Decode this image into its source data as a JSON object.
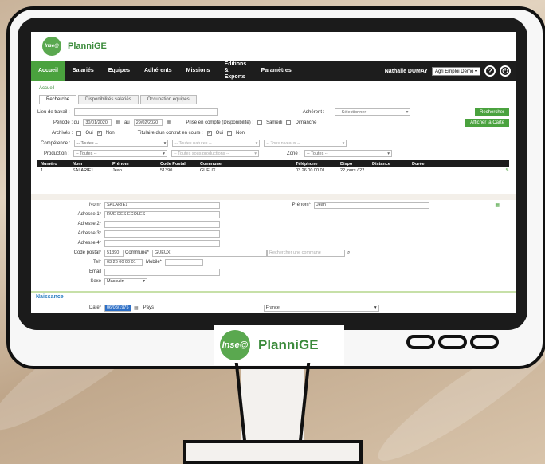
{
  "app": {
    "name": "PlanniGE",
    "logo_text": "Inse@"
  },
  "nav": {
    "items": [
      "Accueil",
      "Salariés",
      "Equipes",
      "Adhérents",
      "Missions",
      "Editions & Exports",
      "Paramètres"
    ],
    "user": "Nathalie DUMAY",
    "company_select": "Agri Emploi Demo",
    "help_icon": "help-icon",
    "power_icon": "power-icon"
  },
  "breadcrumb": "Accueil",
  "tabs": [
    "Recherche",
    "Disponibilités salariés",
    "Occupation équipes"
  ],
  "search": {
    "lieu_label": "Lieu de travail :",
    "adherent_label": "Adhérent :",
    "adherent_value": "-- Sélectionner --",
    "search_button": "Rechercher",
    "map_button": "Afficher la Carte",
    "periode_label": "Période : du",
    "date_from": "30/01/2020",
    "au_label": "au",
    "date_to": "29/02/2020",
    "prise_label": "Prise en compte (Disponibilité) :",
    "samedi": "Samedi",
    "dimanche": "Dimanche",
    "archives_label": "Archivés :",
    "oui": "Oui",
    "non": "Non",
    "titulaire_label": "Titulaire d'un contrat en cours :",
    "competence_label": "Compétence :",
    "competence_value": "-- Toutes --",
    "natures_value": "-- Toutes natures --",
    "niveaux_value": "-- Tous niveaux --",
    "production_label": "Production :",
    "production_value": "-- Toutes --",
    "productions_value": "-- Toutes sous productions --",
    "zone_label": "Zone :",
    "zone_value": "-- Toutes --"
  },
  "table": {
    "headers": [
      "Numéro",
      "Nom",
      "Prénom",
      "Code Postal",
      "Commune",
      "Téléphone",
      "Dispo",
      "Distance",
      "Durée"
    ],
    "rows": [
      [
        "1",
        "SALARIE1",
        "Jean",
        "51390",
        "GUEUX",
        "03 26 00 00 01",
        "22 jours / 22",
        "",
        ""
      ]
    ]
  },
  "form": {
    "nom_label": "Nom*",
    "nom_value": "SALARIE1",
    "prenom_label": "Prénom*",
    "prenom_value": "Jean",
    "adresse1_label": "Adresse 1*",
    "adresse1_value": "RUE DES ECOLES",
    "adresse2_label": "Adresse 2*",
    "adresse3_label": "Adresse 3*",
    "adresse4_label": "Adresse 4*",
    "cp_label": "Code postal*",
    "cp_value": "51390",
    "commune_label": "Commune*",
    "commune_value": "GUEUX",
    "commune_search_placeholder": "Rechercher une commune",
    "tel_label": "Tel*",
    "tel_value": "03 26 00 00 01",
    "mobile_label": "Mobile*",
    "email_label": "Email",
    "sexe_label": "Sexe",
    "sexe_value": "Masculin"
  },
  "naissance": {
    "title": "Naissance",
    "date_label": "Date*",
    "date_value": "06/08/1975",
    "pays_label": "Pays",
    "pays_value": "France"
  },
  "colors": {
    "brand_green": "#4aa23e",
    "nav_dark": "#1d1d1d",
    "section_blue": "#2b7fc2"
  }
}
